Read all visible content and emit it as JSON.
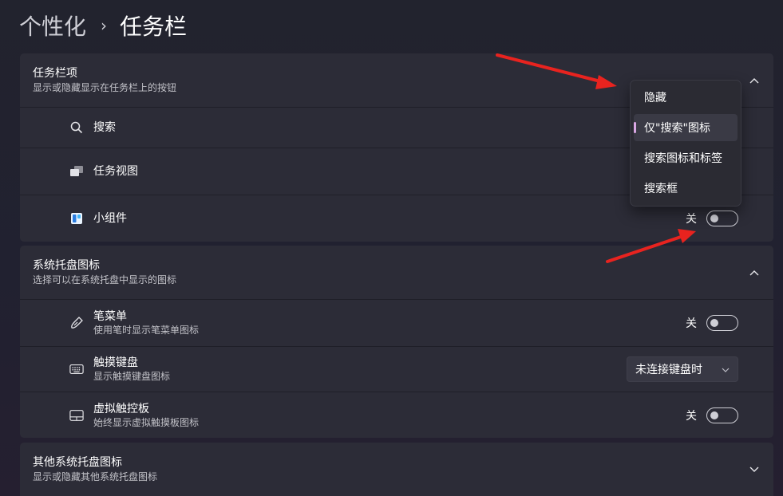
{
  "breadcrumb": {
    "parent": "个性化",
    "separator": "›",
    "current": "任务栏"
  },
  "taskbar_items": {
    "title": "任务栏项",
    "subtitle": "显示或隐藏显示在任务栏上的按钮",
    "rows": [
      {
        "label": "搜索",
        "icon": "search-icon"
      },
      {
        "label": "任务视图",
        "icon": "task-view-icon"
      },
      {
        "label": "小组件",
        "icon": "widgets-icon",
        "state": "关",
        "toggle_on": false
      }
    ]
  },
  "search_flyout": {
    "options": [
      "隐藏",
      "仅\"搜索\"图标",
      "搜索图标和标签",
      "搜索框"
    ],
    "selected_index": 1
  },
  "tray_icons": {
    "title": "系统托盘图标",
    "subtitle": "选择可以在系统托盘中显示的图标",
    "rows": [
      {
        "label": "笔菜单",
        "desc": "使用笔时显示笔菜单图标",
        "icon": "pen-icon",
        "state": "关",
        "toggle_on": false
      },
      {
        "label": "触摸键盘",
        "desc": "显示触摸键盘图标",
        "icon": "keyboard-icon",
        "select_value": "未连接键盘时"
      },
      {
        "label": "虚拟触控板",
        "desc": "始终显示虚拟触摸板图标",
        "icon": "touchpad-icon",
        "state": "关",
        "toggle_on": false
      }
    ]
  },
  "other_tray": {
    "title": "其他系统托盘图标",
    "subtitle": "显示或隐藏其他系统托盘图标"
  },
  "colors": {
    "accent_indicator": "#d9a7e4",
    "annotation_arrow": "#e8231f",
    "card_bg": "#2c2c37"
  }
}
